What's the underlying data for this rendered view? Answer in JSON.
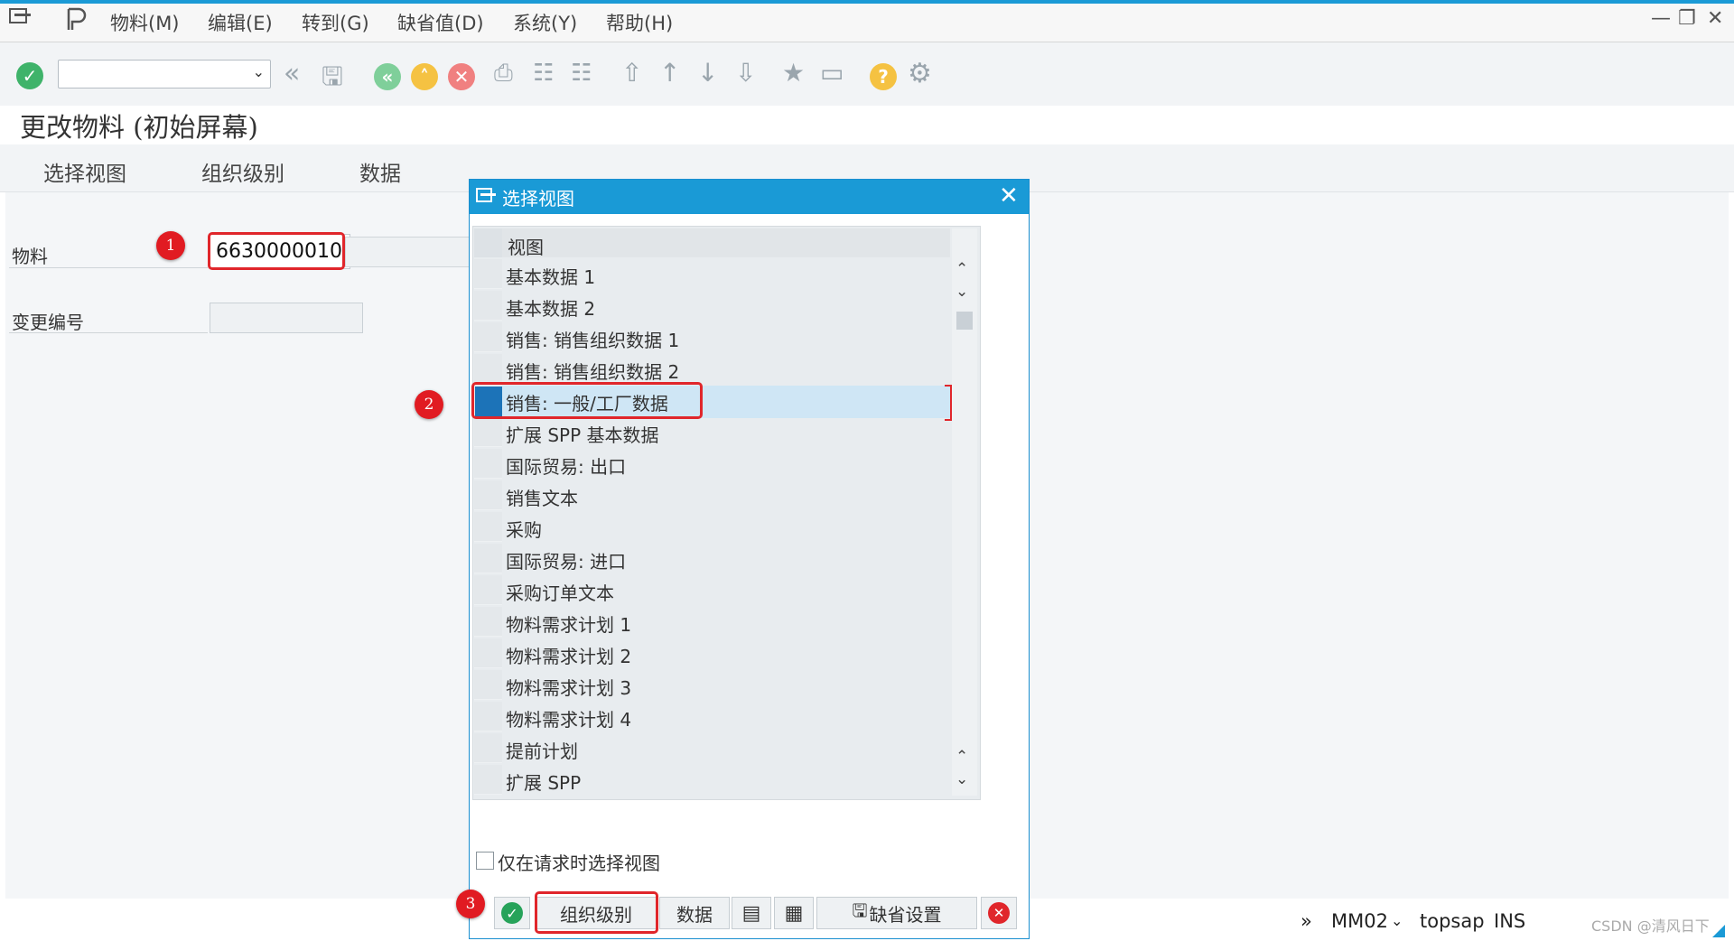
{
  "menu": {
    "items": [
      "物料(M)",
      "编辑(E)",
      "转到(G)",
      "缺省值(D)",
      "系统(Y)",
      "帮助(H)"
    ]
  },
  "screen": {
    "title": "更改物料 (初始屏幕)",
    "app_buttons": [
      "选择视图",
      "组织级别",
      "数据"
    ]
  },
  "form": {
    "material_label": "物料",
    "material_value": "6630000010",
    "change_number_label": "变更编号",
    "change_number_value": ""
  },
  "dialog": {
    "title": "选择视图",
    "column_header": "视图",
    "views": [
      "基本数据 1",
      "基本数据 2",
      "销售: 销售组织数据 1",
      "销售: 销售组织数据 2",
      "销售: 一般/工厂数据",
      "扩展 SPP 基本数据",
      "国际贸易: 出口",
      "销售文本",
      "采购",
      "国际贸易: 进口",
      "采购订单文本",
      "物料需求计划 1",
      "物料需求计划 2",
      "物料需求计划 3",
      "物料需求计划 4",
      "提前计划",
      "扩展 SPP"
    ],
    "selected_view": "销售: 一般/工厂数据",
    "checkbox_label": "仅在请求时选择视图",
    "checkbox_checked": false,
    "buttons": {
      "org_levels": "组织级别",
      "data": "数据",
      "default_settings": "缺省设置"
    }
  },
  "annotations": [
    "1",
    "2",
    "3"
  ],
  "status": {
    "transaction": "MM02",
    "system": "topsap",
    "mode": "INS",
    "watermark": "CSDN @清风日下"
  },
  "colors": {
    "accent": "#1a9ad6",
    "selection": "#1c73b8",
    "annotation_red": "#e0262b",
    "ok_green": "#27a35a",
    "cancel_red": "#e0262b"
  }
}
